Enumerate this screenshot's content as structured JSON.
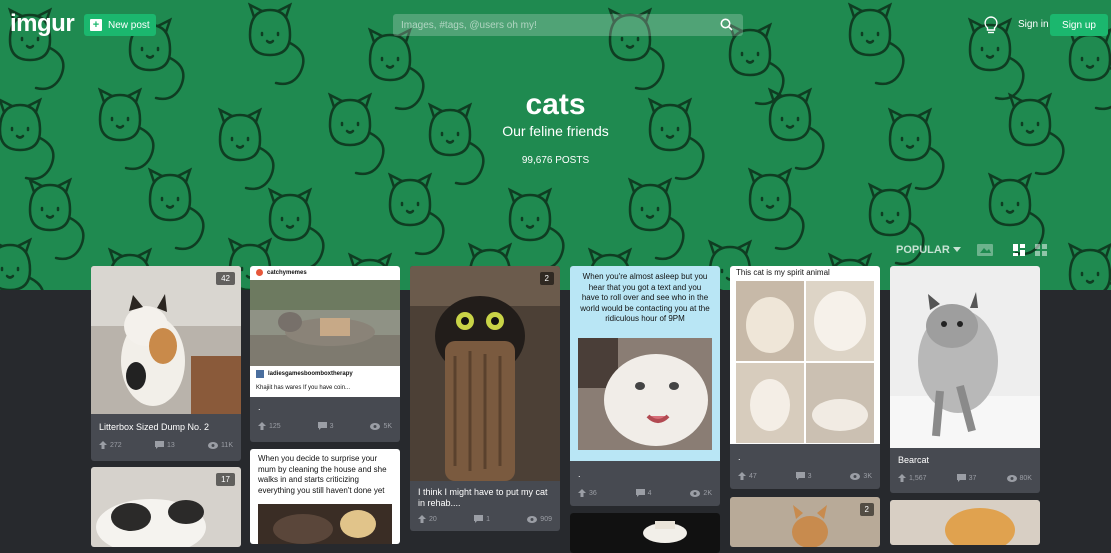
{
  "header": {
    "logo": "imgur",
    "new_post_label": "New post",
    "search_placeholder": "Images, #tags, @users oh my!",
    "signin_label": "Sign in",
    "signup_label": "Sign up"
  },
  "tag": {
    "title": "cats",
    "description": "Our feline friends",
    "post_count": "99,676 POSTS"
  },
  "sort": {
    "label": "POPULAR"
  },
  "colors": {
    "hero": "#1f8a50",
    "accent": "#1bb76e",
    "page": "#27292d",
    "card": "#474a51"
  },
  "posts": [
    {
      "title": "Litterbox Sized Dump No. 2",
      "badge": "42",
      "upvotes": "272",
      "comments": "13",
      "views": "11K"
    },
    {
      "title": ".",
      "caption_top": "catchymemes",
      "caption_user": "ladiesgamesboomboxtherapy",
      "caption_text": "Khajiit has wares If you have coin...",
      "upvotes": "125",
      "comments": "3",
      "views": "5K"
    },
    {
      "title": "I think I might have to put my cat in rehab....",
      "badge": "2",
      "upvotes": "20",
      "comments": "1",
      "views": "909"
    },
    {
      "title": ".",
      "caption_text": "When you're almost asleep but you hear that you got a text and you have to roll over and see who in the world would be contacting you at the ridiculous hour of 9PM",
      "upvotes": "36",
      "comments": "4",
      "views": "2K"
    },
    {
      "title": ".",
      "caption_text": "This cat is my spirit animal",
      "upvotes": "47",
      "comments": "3",
      "views": "3K"
    },
    {
      "title": "Bearcat",
      "upvotes": "1,567",
      "comments": "37",
      "views": "80K"
    },
    {
      "badge": "17"
    },
    {
      "caption_text": "When you decide to surprise your mum by cleaning the house and she walks in and starts criticizing everything you still haven't done yet"
    },
    {},
    {
      "badge": "2"
    },
    {}
  ]
}
